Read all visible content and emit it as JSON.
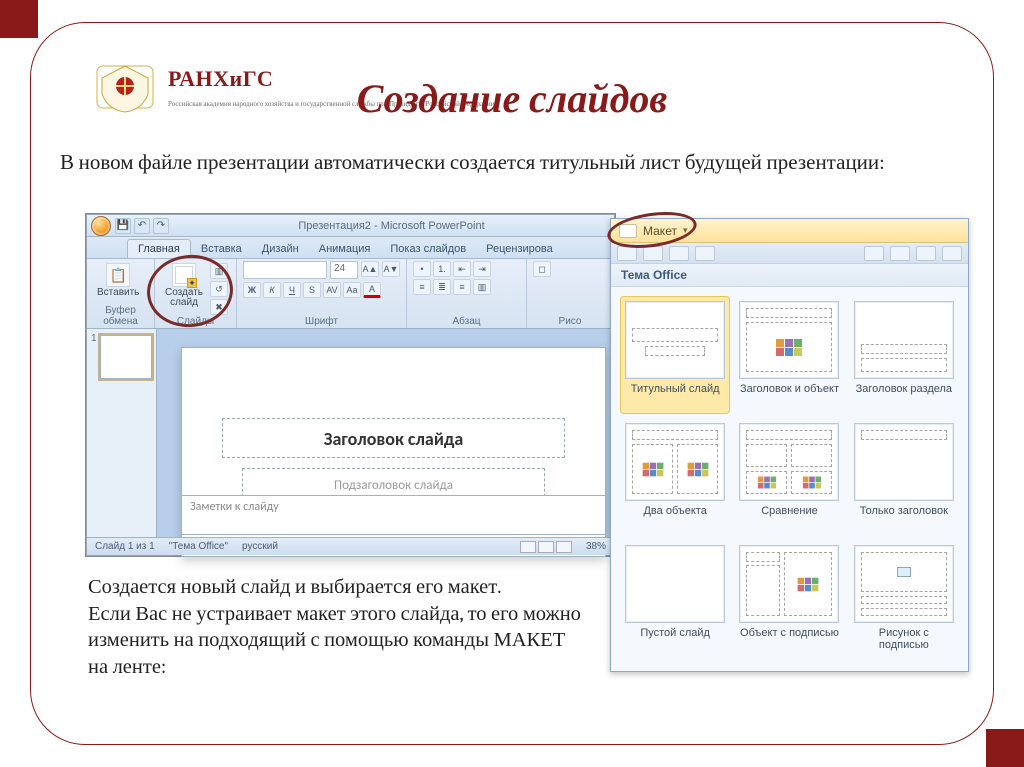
{
  "logo": {
    "brand": "РАНХиГС",
    "sub": "Российская академия народного хозяйства и государственной службы при Президенте Российской Федерации"
  },
  "title": "Создание слайдов",
  "lead": "В новом файле презентации автоматически создается титульный лист будущей презентации:",
  "para2": "Создается новый слайд и выбирается его макет.\nЕсли Вас не устраивает макет этого слайда, то его можно изменить на подходящий с помощью команды МАКЕТ на ленте:",
  "pp": {
    "windowTitle": "Презентация2 - Microsoft PowerPoint",
    "tabs": [
      "Главная",
      "Вставка",
      "Дизайн",
      "Анимация",
      "Показ слайдов",
      "Рецензирова"
    ],
    "activeTab": "Главная",
    "groups": {
      "clipboard": {
        "label": "Буфер обмена",
        "paste": "Вставить"
      },
      "slides": {
        "label": "Слайды",
        "newSlide": "Создать\nслайд"
      },
      "font": {
        "label": "Шрифт",
        "fontSize": "24"
      },
      "para": {
        "label": "Абзац"
      },
      "draw": {
        "label": "Рисо"
      }
    },
    "slide": {
      "titlePh": "Заголовок слайда",
      "subPh": "Подзаголовок слайда"
    },
    "notes": "Заметки к слайду",
    "status": {
      "slideOf": "Слайд 1 из 1",
      "theme": "\"Тема Office\"",
      "lang": "русский",
      "zoom": "38%"
    },
    "thumbNum": "1"
  },
  "layouts": {
    "button": "Макет",
    "theme": "Тема Office",
    "items": [
      {
        "cap": "Титульный слайд"
      },
      {
        "cap": "Заголовок и объект"
      },
      {
        "cap": "Заголовок раздела"
      },
      {
        "cap": "Два объекта"
      },
      {
        "cap": "Сравнение"
      },
      {
        "cap": "Только заголовок"
      },
      {
        "cap": "Пустой слайд"
      },
      {
        "cap": "Объект с подписью"
      },
      {
        "cap": "Рисунок с подписью"
      }
    ]
  }
}
